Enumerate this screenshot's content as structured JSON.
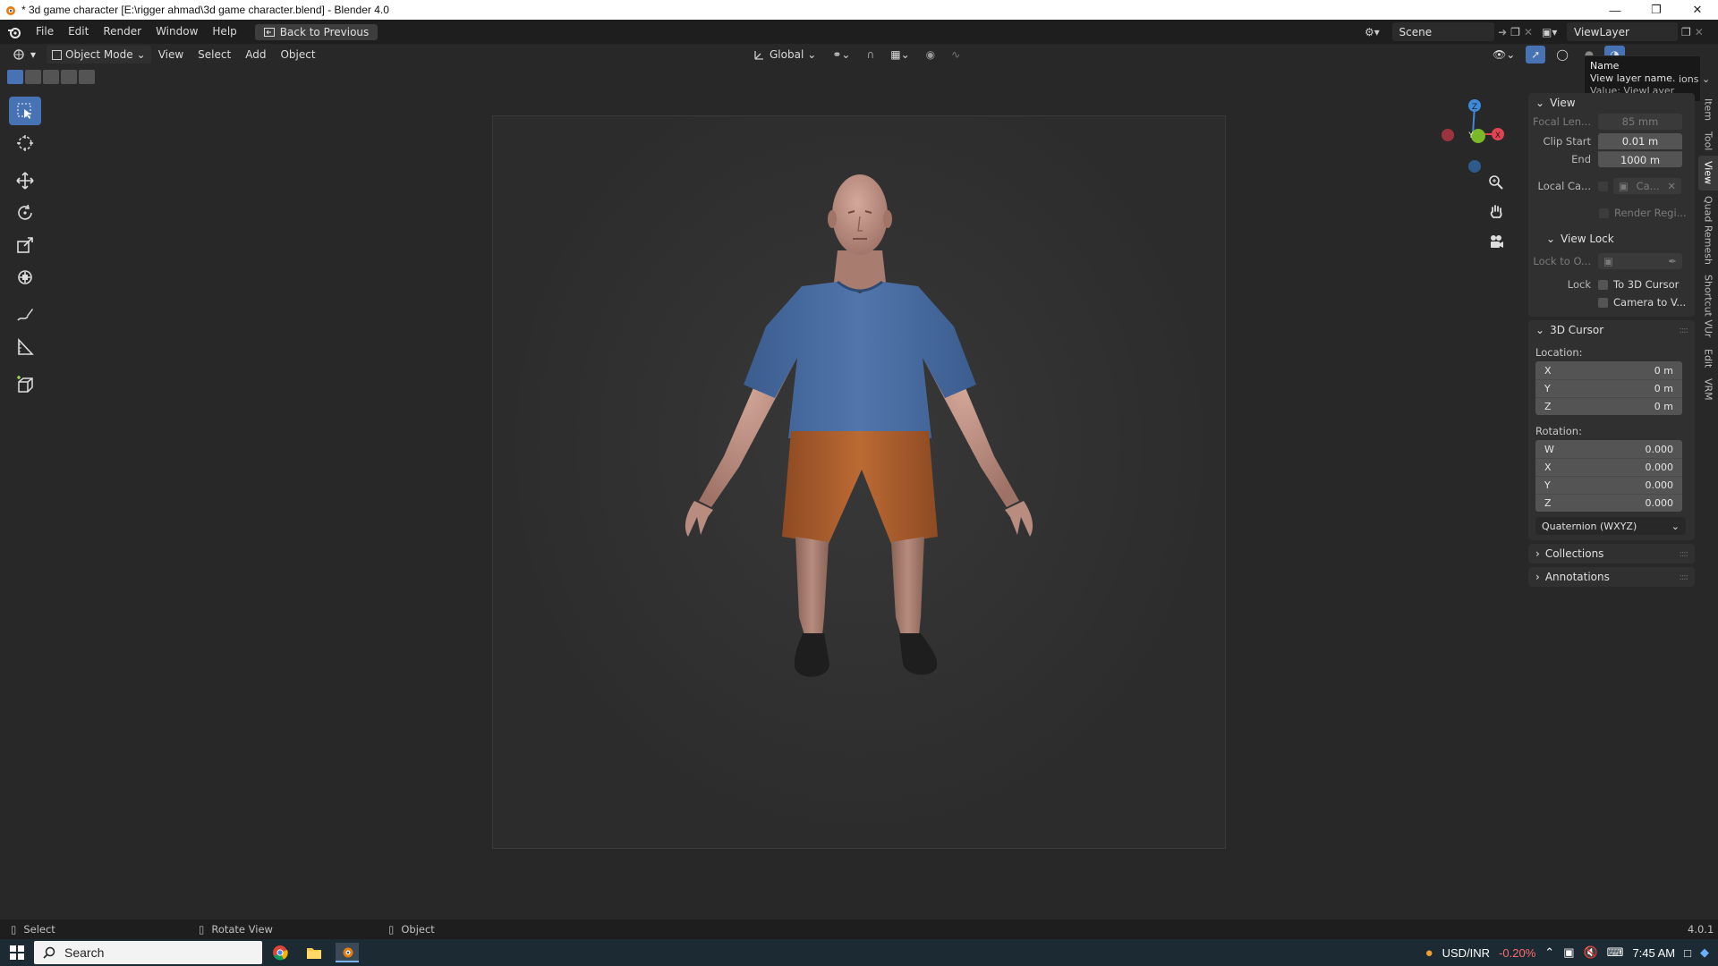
{
  "window": {
    "title": "* 3d game character [E:\\rigger ahmad\\3d game character.blend] - Blender 4.0"
  },
  "menubar": {
    "items": [
      "File",
      "Edit",
      "Render",
      "Window",
      "Help"
    ],
    "back_button": "Back to Previous",
    "scene": "Scene",
    "view_layer": "ViewLayer"
  },
  "viewport_header": {
    "mode": "Object Mode",
    "menus": [
      "View",
      "Select",
      "Add",
      "Object"
    ],
    "transform_orientation": "Global",
    "options_label": "ions"
  },
  "tooltip": {
    "title": "Name",
    "description": "View layer name.",
    "value": "Value: ViewLayer"
  },
  "sidebar": {
    "view_panel": {
      "title": "View",
      "focal_length_label": "Focal Len...",
      "focal_length_value": "85 mm",
      "clip_start_label": "Clip Start",
      "clip_start_value": "0.01 m",
      "clip_end_label": "End",
      "clip_end_value": "1000 m",
      "local_camera_label": "Local Ca...",
      "local_camera_value": "Ca...",
      "render_region_label": "Render Regi...",
      "view_lock_title": "View Lock",
      "lock_to_object_label": "Lock to O...",
      "lock_label": "Lock",
      "to_3d_cursor_label": "To 3D Cursor",
      "camera_to_view_label": "Camera to V..."
    },
    "cursor_panel": {
      "title": "3D Cursor",
      "location_label": "Location:",
      "location": [
        {
          "axis": "X",
          "value": "0 m"
        },
        {
          "axis": "Y",
          "value": "0 m"
        },
        {
          "axis": "Z",
          "value": "0 m"
        }
      ],
      "rotation_label": "Rotation:",
      "rotation": [
        {
          "axis": "W",
          "value": "0.000"
        },
        {
          "axis": "X",
          "value": "0.000"
        },
        {
          "axis": "Y",
          "value": "0.000"
        },
        {
          "axis": "Z",
          "value": "0.000"
        }
      ],
      "rotation_mode": "Quaternion (WXYZ)"
    },
    "collections_title": "Collections",
    "annotations_title": "Annotations"
  },
  "vertical_tabs": [
    "Item",
    "Tool",
    "View",
    "Quad Remesh",
    "Shortcut VUr",
    "Edit",
    "VRM"
  ],
  "gizmo": {
    "x": "X",
    "y": "Y",
    "z": "Z"
  },
  "statusbar": {
    "select": "Select",
    "rotate": "Rotate View",
    "object": "Object",
    "version": "4.0.1"
  },
  "taskbar": {
    "search": "Search",
    "ticker": "USD/INR",
    "ticker_change": "-0.20%",
    "time": "7:45 AM"
  },
  "colors": {
    "accent": "#4772b3",
    "shirt": "#4a6ea3",
    "shorts": "#b4622e",
    "skin": "#c4988a",
    "shoes": "#1c1c1c",
    "axis_x": "#e04452",
    "axis_y": "#7bb82a",
    "axis_z": "#3e8ad6",
    "ticker_negative": "#ff6b6b"
  }
}
